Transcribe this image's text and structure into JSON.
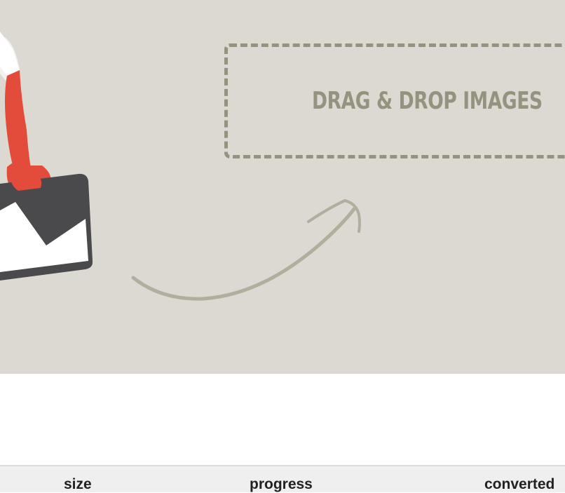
{
  "dropzone": {
    "label": "DRAG & DROP IMAGES"
  },
  "colors": {
    "hero_background": "#dbd9d2",
    "dropzone_border": "#94937f",
    "dropzone_text": "#94937f",
    "illustration_red": "#e34b3b",
    "illustration_dark": "#4a4a4c",
    "header_background": "#efefef"
  },
  "icons": {
    "illustration": "hand-holding-image-icon",
    "arrow": "curved-arrow-icon"
  },
  "table": {
    "columns": [
      "size",
      "progress",
      "converted"
    ]
  }
}
